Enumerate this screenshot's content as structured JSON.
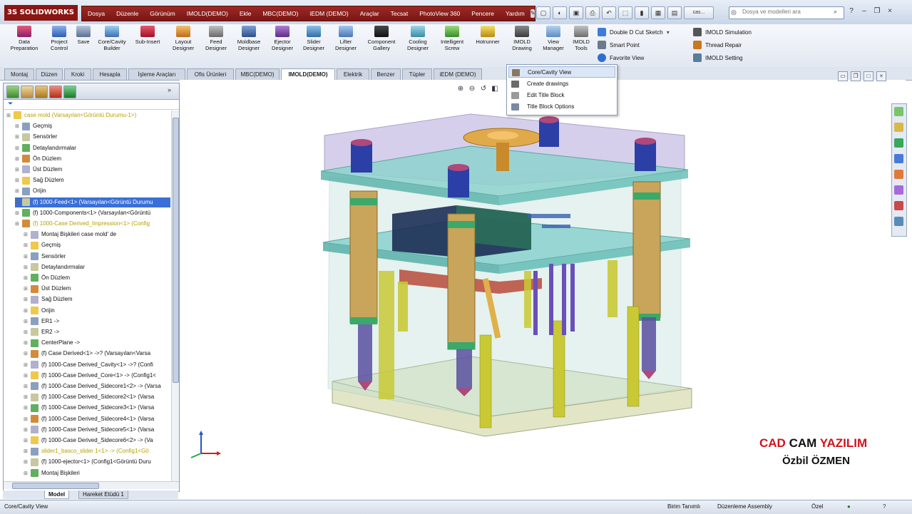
{
  "titlebar": {
    "logo_text": "3S SOLIDWORKS",
    "menus": [
      "Dosya",
      "Düzenle",
      "Görünüm",
      "IMOLD(DEMO)",
      "Ekle",
      "MBC(DEMO)",
      "iEDM (DEMO)",
      "Araçlar",
      "Tecsat",
      "PhotoView 360",
      "Pencere",
      "Yardım"
    ],
    "pin_icon": "pin-icon",
    "search_placeholder": "Dosya ve modelleri ara",
    "doc_title": "cas..."
  },
  "command_manager": {
    "buttons": [
      "Data Preparation",
      "Project Control",
      "Save",
      "Core/Cavity Builder",
      "Sub-Insert",
      "Layout Designer",
      "Feed Designer",
      "Moldbase Designer",
      "Ejector Designer",
      "Slider Designer",
      "Lifter Designer",
      "Component Gallery",
      "Cooling Designer",
      "Intelligent Screw",
      "Hotrunner",
      "IMOLD Drawing",
      "View Manager",
      "IMOLD Tools"
    ],
    "side_commands": [
      "Double D Cut Sketch",
      "Smart Point",
      "Favorite View",
      "IMOLD Simulation",
      "Thread Repair",
      "IMOLD Setting"
    ]
  },
  "tabs": [
    "Montaj",
    "Düzen",
    "Kroki",
    "Hesapla",
    "İşleme Araçları",
    "Ofis Ürünleri",
    "MBC(DEMO)",
    "IMOLD(DEMO)",
    "Elektrik",
    "Benzer",
    "Tüpler",
    "iEDM (DEMO)"
  ],
  "active_tab": "IMOLD(DEMO)",
  "feature_tree": [
    {
      "label": "case mold  (Varsayılan<Görüntü Durumu-1>)",
      "level": 0,
      "style": "yel"
    },
    {
      "label": "Geçmiş",
      "level": 1
    },
    {
      "label": "Sensörler",
      "level": 1
    },
    {
      "label": "Detaylandırmalar",
      "level": 1
    },
    {
      "label": "Ön Düzlem",
      "level": 1
    },
    {
      "label": "Üst Düzlem",
      "level": 1
    },
    {
      "label": "Sağ Düzlem",
      "level": 1
    },
    {
      "label": "Orijin",
      "level": 1
    },
    {
      "label": "(f) 1000-Feed<1> (Varsayılan<Görüntü Durumu",
      "level": 1,
      "style": "sel"
    },
    {
      "label": "(f) 1000-Components<1> (Varsayılan<Görüntü",
      "level": 1
    },
    {
      "label": "(f) 1000-Case Derived_Impression<1> (Config",
      "level": 1,
      "style": "yel"
    },
    {
      "label": "Montaj Bişkileri case mold' de",
      "level": 2
    },
    {
      "label": "Geçmiş",
      "level": 2
    },
    {
      "label": "Sensörler",
      "level": 2
    },
    {
      "label": "Detaylandırmalar",
      "level": 2
    },
    {
      "label": "Ön Düzlem",
      "level": 2
    },
    {
      "label": "Üst Düzlem",
      "level": 2
    },
    {
      "label": "Sağ Düzlem",
      "level": 2
    },
    {
      "label": "Orijin",
      "level": 2
    },
    {
      "label": "ER1 ->",
      "level": 2
    },
    {
      "label": "ER2 ->",
      "level": 2
    },
    {
      "label": "CenterPlane ->",
      "level": 2
    },
    {
      "label": "(f) Case Derived<1> ->? (Varsayılan<Varsa",
      "level": 2
    },
    {
      "label": "(f) 1000-Case Derived_Cavity<1> ->? (Confi",
      "level": 2
    },
    {
      "label": "(f) 1000-Case Derived_Core<1> -> (Config1<",
      "level": 2
    },
    {
      "label": "(f) 1000-Case Derived_Sidecore1<2> -> (Varsa",
      "level": 2
    },
    {
      "label": "(f) 1000-Case Derived_Sidecore2<1> (Varsa",
      "level": 2
    },
    {
      "label": "(f) 1000-Case Derived_Sidecore3<1> (Varsa",
      "level": 2
    },
    {
      "label": "(f) 1000-Case Derived_Sidecore4<1> (Varsa",
      "level": 2
    },
    {
      "label": "(f) 1000-Case Derived_Sidecore5<1> (Varsa",
      "level": 2
    },
    {
      "label": "(f) 1000-Case Derived_Sidecore6<2> -> (Va",
      "level": 2
    },
    {
      "label": "slider1_basco_slider 1<1> -> (Config1<Gö",
      "level": 2,
      "style": "yel"
    },
    {
      "label": "(f) 1000-ejector<1> (Config1<Görüntü Duru",
      "level": 2
    },
    {
      "label": "Montaj Bişkileri",
      "level": 2
    }
  ],
  "bottom_tabs": [
    "Model",
    "Hareket Etüdü 1"
  ],
  "dropdown": {
    "items": [
      "Core/Cavity View",
      "Create drawings",
      "Edit Title Block",
      "Title Block Options"
    ],
    "highlighted": "Core/Cavity View"
  },
  "status": {
    "left": "Core/Cavity View",
    "unit": "Birim Tanımlı",
    "mode": "Düzenleme Assembly",
    "custom": "Özel"
  },
  "watermark": {
    "line1_a": "CAD",
    "line1_b": "CAM",
    "line1_c": "YAZILIM",
    "line2": "Özbil ÖZMEN",
    "color_red": "#d4121b",
    "color_dark": "#111111"
  },
  "colors": {
    "menubar": "#8b1512",
    "selection": "#3a6fd8",
    "plate": "#7fc9c4",
    "pillar": "#c8a55a",
    "cap": "#2b3fa6"
  }
}
